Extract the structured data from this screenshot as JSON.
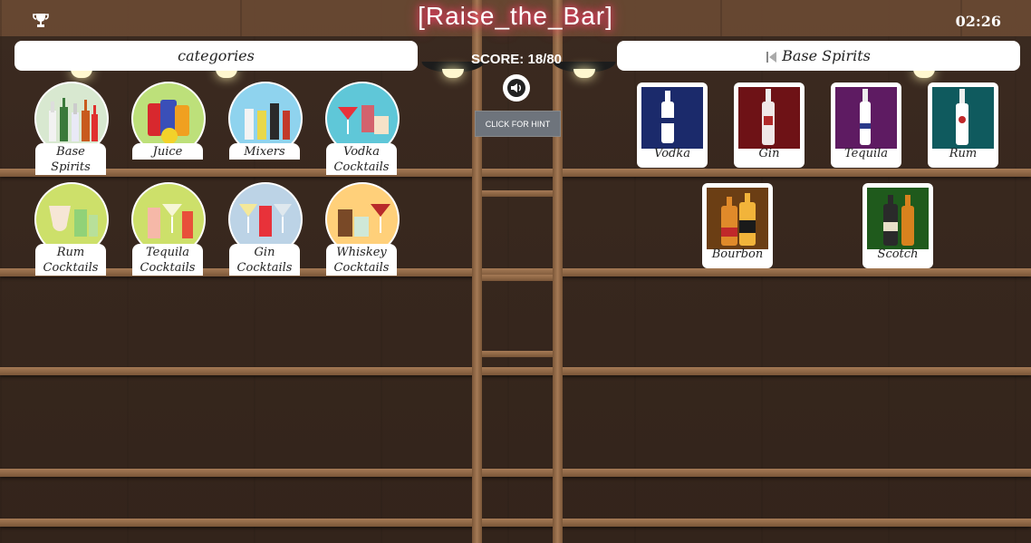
{
  "header": {
    "title": "[Raise_the_Bar]",
    "timer": "02:26",
    "trophy_icon": "trophy-icon"
  },
  "left_panel": {
    "title": "categories",
    "categories": [
      {
        "label": "Base Spirits",
        "color": "#d8e8d0"
      },
      {
        "label": "Juice",
        "color": "#bde07a"
      },
      {
        "label": "Mixers",
        "color": "#8fd3ee"
      },
      {
        "label": "Vodka Cocktails",
        "color": "#5fc7d8"
      },
      {
        "label": "Rum Cocktails",
        "color": "#cde06a"
      },
      {
        "label": "Tequila Cocktails",
        "color": "#cde06a"
      },
      {
        "label": "Gin Cocktails",
        "color": "#bcd3e6"
      },
      {
        "label": "Whiskey Cocktails",
        "color": "#ffd07a"
      }
    ]
  },
  "center": {
    "score_label": "SCORE:",
    "score_value": "18/80",
    "hint_label": "CLICK FOR HINT",
    "sound_icon": "speaker-icon"
  },
  "right_panel": {
    "title": "Base Spirits",
    "back_icon": "skip-back-icon",
    "spirits": [
      {
        "label": "Vodka",
        "color": "#1b2a6b",
        "bottle": "#ffffff"
      },
      {
        "label": "Gin",
        "color": "#6e1216",
        "bottle": "#f0e8e8"
      },
      {
        "label": "Tequila",
        "color": "#5e1b62",
        "bottle": "#ffffff"
      },
      {
        "label": "Rum",
        "color": "#0f5a5e",
        "bottle": "#ffffff"
      },
      {
        "label": "Bourbon",
        "color": "#6b3e14",
        "bottle": "#e08a2a"
      },
      {
        "label": "Scotch",
        "color": "#1f5a1c",
        "bottle": "#2a2a2a"
      }
    ]
  }
}
